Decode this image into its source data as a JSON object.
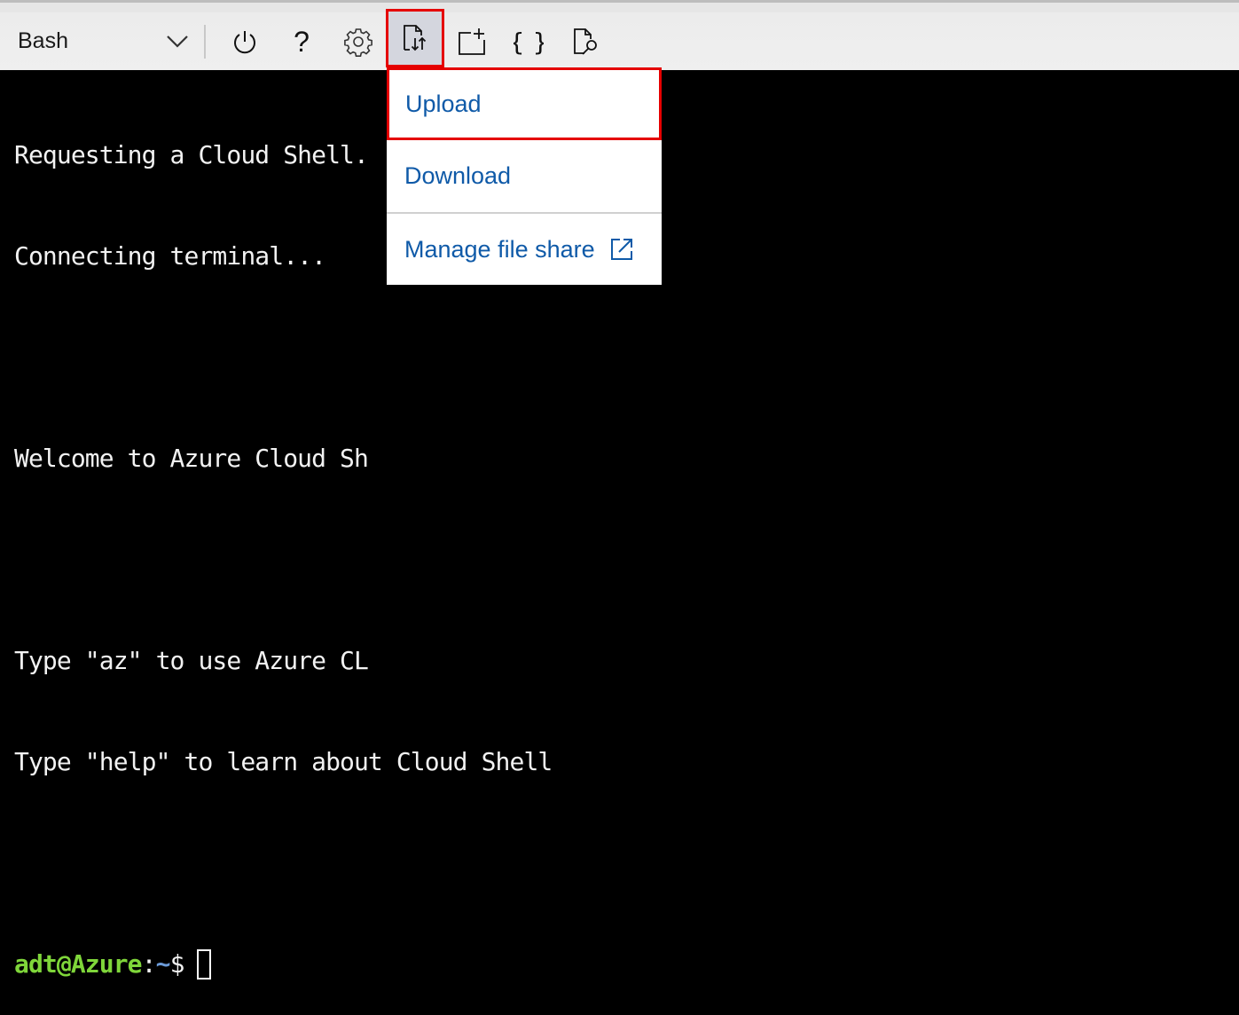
{
  "toolbar": {
    "shell_selector": {
      "value": "Bash",
      "icon": "chevron-down-icon"
    },
    "buttons": [
      {
        "name": "restart",
        "icon": "power-icon",
        "tooltip": ""
      },
      {
        "name": "help",
        "icon": "question-icon"
      },
      {
        "name": "settings",
        "icon": "gear-icon"
      },
      {
        "name": "upload-download-files",
        "icon": "file-transfer-icon",
        "active": true,
        "highlighted": true
      },
      {
        "name": "new-session",
        "icon": "new-session-icon"
      },
      {
        "name": "editor",
        "icon": "braces-icon"
      },
      {
        "name": "web-preview",
        "icon": "file-search-icon"
      }
    ]
  },
  "menu": {
    "items": [
      {
        "label": "Upload",
        "highlighted": true
      },
      {
        "label": "Download"
      },
      {
        "label": "Manage file share",
        "icon": "external-link-icon"
      }
    ]
  },
  "terminal": {
    "lines": [
      "Requesting a Cloud Shell.",
      "Connecting terminal...",
      "",
      "Welcome to Azure Cloud Sh",
      "",
      "Type \"az\" to use Azure CL",
      "Type \"help\" to learn about Cloud Shell"
    ],
    "prompt": {
      "user": "adt@Azure",
      "colon": ":",
      "path": "~",
      "symbol": "$"
    }
  },
  "colors": {
    "highlight": "#e50000",
    "link": "#0f5aa8",
    "prompt_user": "#7fd63a",
    "prompt_path": "#6b9ad8"
  }
}
